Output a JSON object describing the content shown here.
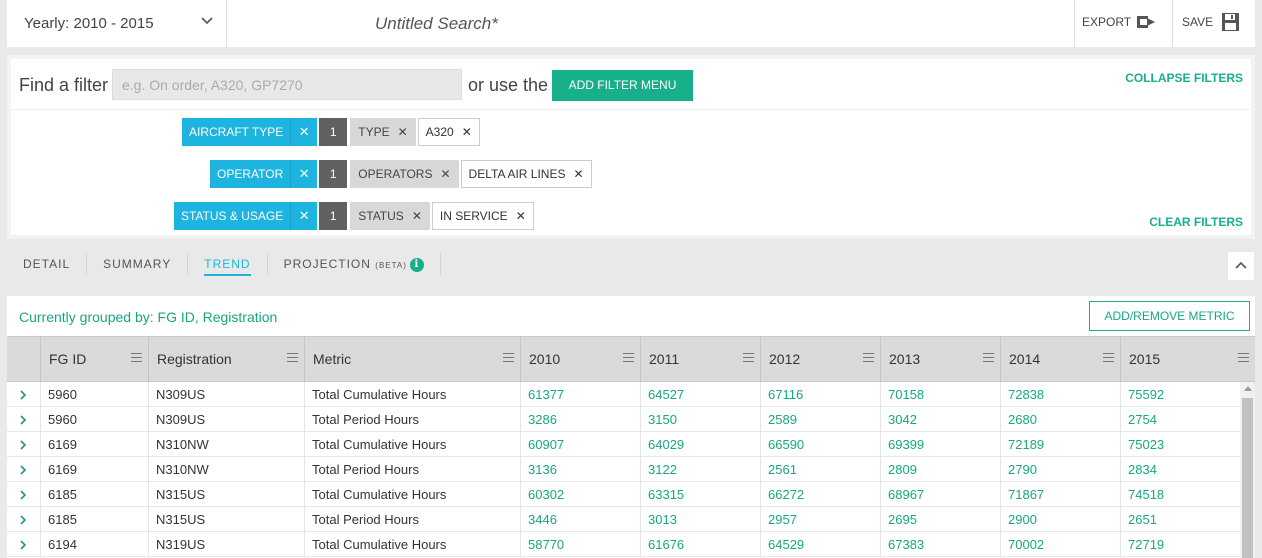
{
  "topbar": {
    "period_label": "Yearly: 2010 - 2015",
    "search_title": "Untitled Search*",
    "export_label": "EXPORT",
    "save_label": "SAVE"
  },
  "filters": {
    "find_label": "Find a filter",
    "find_placeholder": "e.g. On order, A320, GP7270",
    "or_use_label": "or use the",
    "add_filter_label": "ADD FILTER MENU",
    "collapse_label": "COLLAPSE FILTERS",
    "clear_label": "CLEAR FILTERS",
    "rows": [
      {
        "category": "AIRCRAFT TYPE",
        "count": "1",
        "field": "TYPE",
        "value": "A320"
      },
      {
        "category": "OPERATOR",
        "count": "1",
        "field": "OPERATORS",
        "value": "DELTA AIR LINES"
      },
      {
        "category": "STATUS & USAGE",
        "count": "1",
        "field": "STATUS",
        "value": "IN SERVICE"
      }
    ]
  },
  "tabs": [
    {
      "label": "DETAIL",
      "active": false
    },
    {
      "label": "SUMMARY",
      "active": false
    },
    {
      "label": "TREND",
      "active": true
    },
    {
      "label": "PROJECTION",
      "badge": "(BETA)",
      "active": false
    }
  ],
  "table": {
    "grouped_by": "Currently grouped by: FG ID, Registration",
    "add_metric_label": "ADD/REMOVE METRIC",
    "columns": [
      "FG ID",
      "Registration",
      "Metric",
      "2010",
      "2011",
      "2012",
      "2013",
      "2014",
      "2015"
    ],
    "rows": [
      [
        "5960",
        "N309US",
        "Total Cumulative Hours",
        "61377",
        "64527",
        "67116",
        "70158",
        "72838",
        "75592"
      ],
      [
        "5960",
        "N309US",
        "Total Period Hours",
        "3286",
        "3150",
        "2589",
        "3042",
        "2680",
        "2754"
      ],
      [
        "6169",
        "N310NW",
        "Total Cumulative Hours",
        "60907",
        "64029",
        "66590",
        "69399",
        "72189",
        "75023"
      ],
      [
        "6169",
        "N310NW",
        "Total Period Hours",
        "3136",
        "3122",
        "2561",
        "2809",
        "2790",
        "2834"
      ],
      [
        "6185",
        "N315US",
        "Total Cumulative Hours",
        "60302",
        "63315",
        "66272",
        "68967",
        "71867",
        "74518"
      ],
      [
        "6185",
        "N315US",
        "Total Period Hours",
        "3446",
        "3013",
        "2957",
        "2695",
        "2900",
        "2651"
      ],
      [
        "6194",
        "N319US",
        "Total Cumulative Hours",
        "58770",
        "61676",
        "64529",
        "67383",
        "70002",
        "72719"
      ]
    ]
  },
  "colors": {
    "accent_green": "#18b08a",
    "chip_blue": "#1eb4e0",
    "count_grey": "#616161"
  }
}
